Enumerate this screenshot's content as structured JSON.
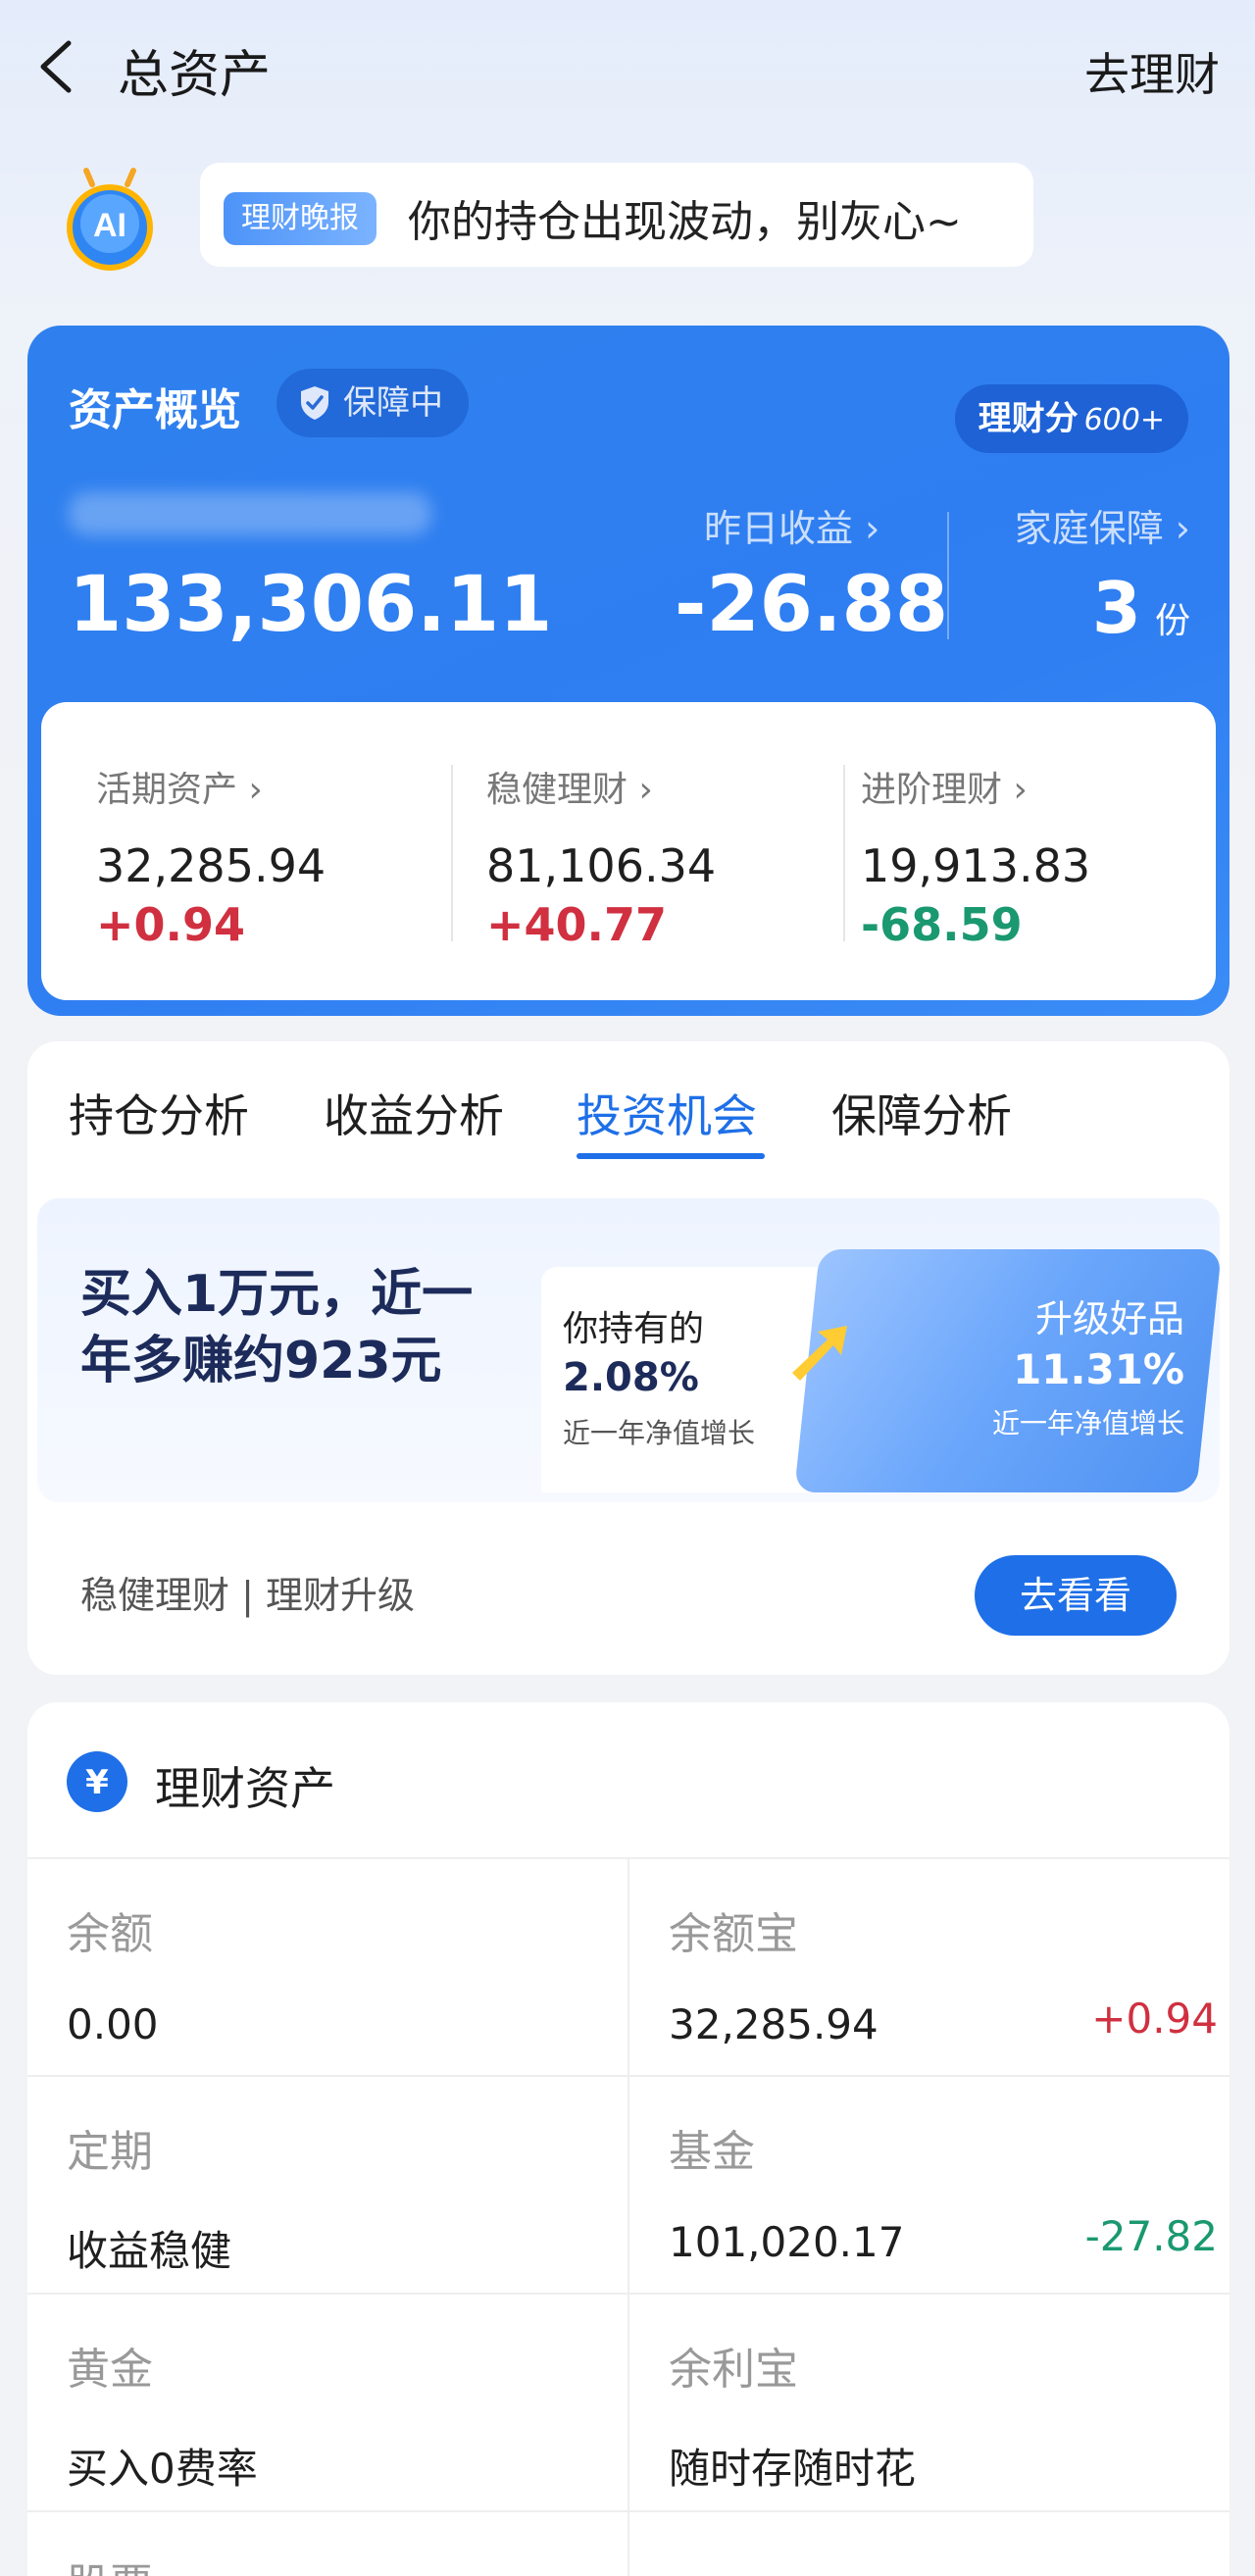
{
  "header": {
    "title": "总资产",
    "action": "去理财"
  },
  "ai": {
    "avatar_text": "AI",
    "badge": "理财晚报",
    "message": "你的持仓出现波动，别灰心~"
  },
  "overview": {
    "title": "资产概览",
    "guard": "保障中",
    "score_label": "理财分",
    "score_value": "600+",
    "total": "133,306.11",
    "yesterday_label": "昨日收益 ›",
    "yesterday_value": "-26.88",
    "family_label": "家庭保障 ›",
    "family_value": "3",
    "family_unit": "份",
    "categories": [
      {
        "label": "活期资产 ›",
        "value": "32,285.94",
        "change": "+0.94"
      },
      {
        "label": "稳健理财 ›",
        "value": "81,106.34",
        "change": "+40.77"
      },
      {
        "label": "进阶理财 ›",
        "value": "19,913.83",
        "change": "-68.59"
      }
    ]
  },
  "analysis": {
    "tabs": [
      "持仓分析",
      "收益分析",
      "投资机会",
      "保障分析"
    ],
    "active_tab": "投资机会",
    "promo_text": "买入1万元，近一年多赚约923元",
    "hold_title": "你持有的",
    "hold_pct": "2.08%",
    "hold_sub": "近一年净值增长",
    "upgrade_title": "升级好品",
    "upgrade_pct": "11.31%",
    "upgrade_sub": "近一年净值增长",
    "tags": "稳健理财 | 理财升级",
    "button": "去看看"
  },
  "wealth": {
    "title": "理财资产",
    "items": [
      {
        "label": "余额",
        "value": "0.00",
        "change": ""
      },
      {
        "label": "余额宝",
        "value": "32,285.94",
        "change": "+0.94"
      },
      {
        "label": "定期",
        "value": "收益稳健",
        "change": ""
      },
      {
        "label": "基金",
        "value": "101,020.17",
        "change": "-27.82"
      },
      {
        "label": "黄金",
        "value": "买入0费率",
        "change": ""
      },
      {
        "label": "余利宝",
        "value": "随时存随时花",
        "change": ""
      },
      {
        "label": "股票",
        "value": "",
        "change": ""
      }
    ]
  },
  "colors": {
    "accent": "#1e6fe8",
    "card_blue": "#2f80ee",
    "positive": "#d03040",
    "negative": "#1a9870"
  }
}
